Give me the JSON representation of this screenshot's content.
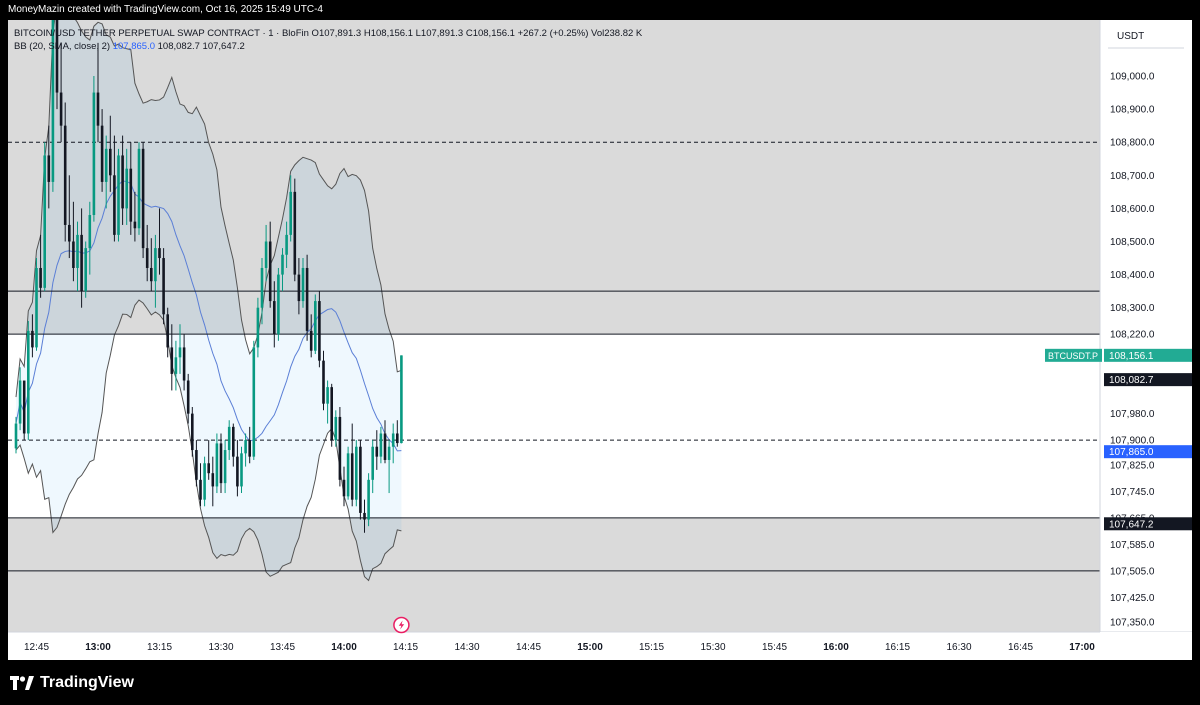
{
  "header": {
    "credit": "MoneyMazin created with TradingView.com, Oct 16, 2025 15:49 UTC-4"
  },
  "legend": {
    "symbol": "BITCOIN/USD TETHER PERPETUAL SWAP CONTRACT · 1 · BloFin",
    "o_label": "O",
    "o": "107,891.3",
    "h_label": "H",
    "h": "108,156.1",
    "l_label": "L",
    "l": "107,891.3",
    "c_label": "C",
    "c": "108,156.1",
    "change": "+267.2 (+0.25%)",
    "vol": "Vol238.82 K",
    "bb_name": "BB (20, SMA, close, 2)",
    "bb_basis": "107,865.0",
    "bb_upper": "108,082.7",
    "bb_lower": "107,647.2"
  },
  "footer": {
    "brand": "TradingView"
  },
  "chart_data": {
    "type": "candlestick",
    "currency": "USDT",
    "y_ticks": [
      "109,000.0",
      "108,900.0",
      "108,800.0",
      "108,700.0",
      "108,600.0",
      "108,500.0",
      "108,400.0",
      "108,300.0",
      "108,220.0",
      "107,980.0",
      "107,900.0",
      "107,825.0",
      "107,745.0",
      "107,665.0",
      "107,585.0",
      "107,505.0",
      "107,425.0",
      "107,350.0"
    ],
    "x_ticks": [
      "12:45",
      "13:00",
      "13:15",
      "13:30",
      "13:45",
      "14:00",
      "14:15",
      "14:30",
      "14:45",
      "15:00",
      "15:15",
      "15:30",
      "15:45",
      "16:00",
      "16:15",
      "16:30",
      "16:45",
      "17:00"
    ],
    "x_bold": [
      "13:00",
      "14:00",
      "15:00",
      "16:00",
      "17:00"
    ],
    "price_labels": [
      {
        "name": "BTCUSDT.P",
        "value": "108,156.1",
        "color": "#22ab94"
      },
      {
        "name": "",
        "value": "108,082.7",
        "color": "#131722"
      },
      {
        "name": "",
        "value": "107,865.0",
        "color": "#2962ff"
      },
      {
        "name": "",
        "value": "107,647.2",
        "color": "#131722"
      }
    ],
    "horizontal_lines": [
      {
        "price": 108800,
        "style": "dashed"
      },
      {
        "price": 108350,
        "style": "solid"
      },
      {
        "price": 108220,
        "style": "solid"
      },
      {
        "price": 107900,
        "style": "dashed"
      },
      {
        "price": 107665,
        "style": "solid"
      },
      {
        "price": 107505,
        "style": "solid"
      }
    ],
    "bands": [
      {
        "from": 109250,
        "to": 108220,
        "color": "#dadada"
      },
      {
        "from": 107665,
        "to": 107290,
        "color": "#dadada"
      }
    ],
    "start_time": "12:40",
    "candles": [
      [
        107875,
        107970,
        107860,
        107950
      ],
      [
        107950,
        108120,
        107930,
        108080
      ],
      [
        108080,
        108050,
        107900,
        107920
      ],
      [
        107920,
        108260,
        107900,
        108230
      ],
      [
        108230,
        108280,
        108150,
        108180
      ],
      [
        108180,
        108450,
        108170,
        108420
      ],
      [
        108420,
        108520,
        108330,
        108360
      ],
      [
        108360,
        108800,
        108350,
        108760
      ],
      [
        108760,
        108850,
        108600,
        108680
      ],
      [
        108680,
        109200,
        108650,
        109180
      ],
      [
        109180,
        109350,
        108900,
        108950
      ],
      [
        108950,
        109100,
        108800,
        108850
      ],
      [
        108850,
        108920,
        108500,
        108550
      ],
      [
        108550,
        108700,
        108450,
        108500
      ],
      [
        108500,
        108620,
        108380,
        108420
      ],
      [
        108420,
        108560,
        108350,
        108520
      ],
      [
        108520,
        108600,
        108300,
        108350
      ],
      [
        108350,
        108500,
        108330,
        108480
      ],
      [
        108480,
        108620,
        108400,
        108580
      ],
      [
        108580,
        109000,
        108560,
        108950
      ],
      [
        108950,
        109100,
        108800,
        108850
      ],
      [
        108850,
        108900,
        108650,
        108680
      ],
      [
        108680,
        108820,
        108600,
        108780
      ],
      [
        108780,
        108880,
        108650,
        108700
      ],
      [
        108700,
        108820,
        108500,
        108520
      ],
      [
        108520,
        108780,
        108500,
        108760
      ],
      [
        108760,
        108820,
        108550,
        108600
      ],
      [
        108600,
        108780,
        108550,
        108720
      ],
      [
        108720,
        108800,
        108520,
        108560
      ],
      [
        108560,
        108650,
        108500,
        108540
      ],
      [
        108540,
        108800,
        108520,
        108780
      ],
      [
        108780,
        108800,
        108450,
        108480
      ],
      [
        108480,
        108550,
        108380,
        108420
      ],
      [
        108420,
        108510,
        108350,
        108380
      ],
      [
        108380,
        108520,
        108300,
        108480
      ],
      [
        108480,
        108600,
        108400,
        108450
      ],
      [
        108450,
        108480,
        108250,
        108280
      ],
      [
        108280,
        108300,
        108150,
        108180
      ],
      [
        108180,
        108250,
        108050,
        108100
      ],
      [
        108100,
        108200,
        108050,
        108150
      ],
      [
        108150,
        108250,
        108100,
        108180
      ],
      [
        108180,
        108220,
        108050,
        108080
      ],
      [
        108080,
        108100,
        107950,
        107980
      ],
      [
        107980,
        108000,
        107850,
        107870
      ],
      [
        107870,
        107900,
        107760,
        107780
      ],
      [
        107780,
        107830,
        107700,
        107720
      ],
      [
        107720,
        107850,
        107700,
        107830
      ],
      [
        107830,
        107900,
        107780,
        107800
      ],
      [
        107800,
        107850,
        107700,
        107760
      ],
      [
        107760,
        107920,
        107740,
        107890
      ],
      [
        107890,
        107920,
        107740,
        107770
      ],
      [
        107770,
        107900,
        107740,
        107870
      ],
      [
        107870,
        107960,
        107840,
        107940
      ],
      [
        107940,
        107950,
        107820,
        107850
      ],
      [
        107850,
        107900,
        107730,
        107760
      ],
      [
        107760,
        107880,
        107740,
        107860
      ],
      [
        107860,
        107920,
        107820,
        107900
      ],
      [
        107900,
        107940,
        107830,
        107850
      ],
      [
        107850,
        108200,
        107840,
        108180
      ],
      [
        108180,
        108330,
        108150,
        108300
      ],
      [
        108300,
        108450,
        108250,
        108420
      ],
      [
        108420,
        108550,
        108380,
        108500
      ],
      [
        108500,
        108560,
        108300,
        108320
      ],
      [
        108320,
        108380,
        108180,
        108220
      ],
      [
        108220,
        108420,
        108200,
        108400
      ],
      [
        108400,
        108480,
        108350,
        108460
      ],
      [
        108460,
        108560,
        108420,
        108520
      ],
      [
        108520,
        108700,
        108500,
        108650
      ],
      [
        108650,
        108690,
        108380,
        108400
      ],
      [
        108400,
        108450,
        108280,
        108320
      ],
      [
        108320,
        108450,
        108300,
        108420
      ],
      [
        108420,
        108460,
        108200,
        108230
      ],
      [
        108230,
        108280,
        108150,
        108170
      ],
      [
        108170,
        108340,
        108160,
        108320
      ],
      [
        108320,
        108350,
        108120,
        108140
      ],
      [
        108140,
        108170,
        107990,
        108010
      ],
      [
        108010,
        108080,
        107950,
        108060
      ],
      [
        108060,
        108070,
        107880,
        107900
      ],
      [
        107900,
        107990,
        107880,
        107970
      ],
      [
        107970,
        108000,
        107760,
        107780
      ],
      [
        107780,
        107820,
        107700,
        107730
      ],
      [
        107730,
        107880,
        107720,
        107860
      ],
      [
        107860,
        107950,
        107700,
        107720
      ],
      [
        107720,
        107900,
        107700,
        107880
      ],
      [
        107880,
        107900,
        107660,
        107680
      ],
      [
        107680,
        107720,
        107620,
        107660
      ],
      [
        107660,
        107800,
        107640,
        107780
      ],
      [
        107780,
        107900,
        107740,
        107880
      ],
      [
        107880,
        107930,
        107810,
        107850
      ],
      [
        107850,
        107940,
        107830,
        107920
      ],
      [
        107920,
        107960,
        107830,
        107840
      ],
      [
        107840,
        107900,
        107740,
        107880
      ],
      [
        107880,
        107950,
        107830,
        107920
      ],
      [
        107920,
        107960,
        107880,
        107891
      ],
      [
        107891,
        108156,
        107890,
        108156
      ]
    ]
  }
}
